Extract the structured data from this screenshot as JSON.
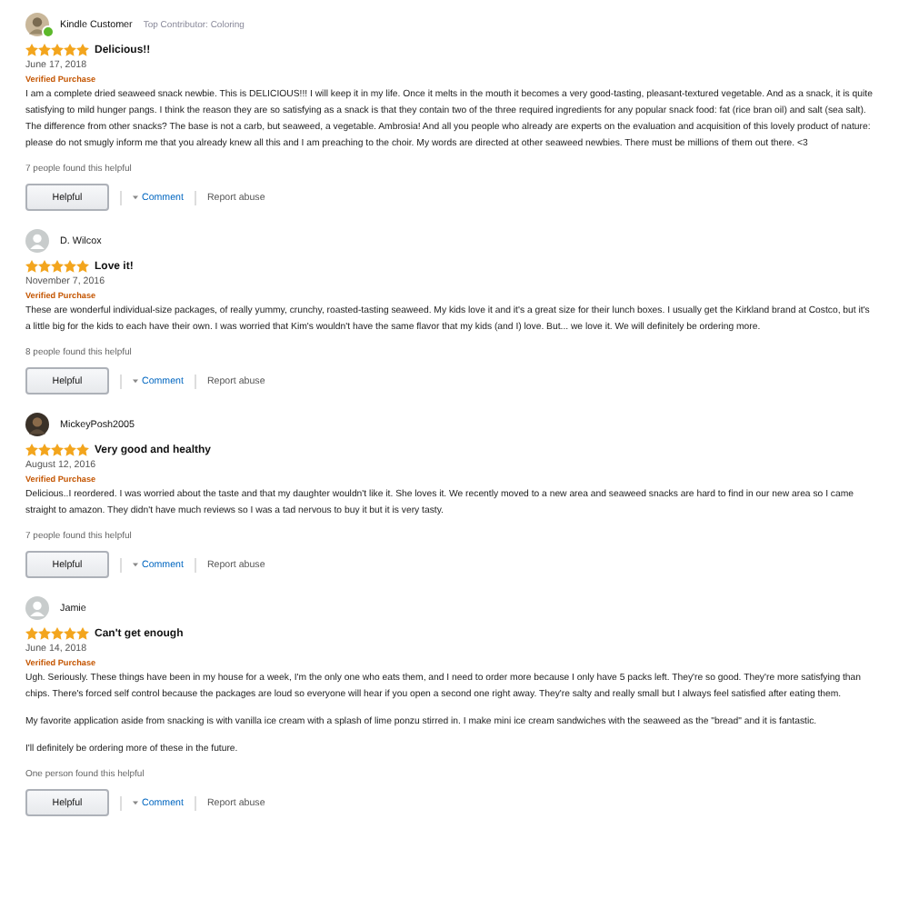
{
  "reviews": [
    {
      "reviewer": {
        "name": "Kindle Customer",
        "badge_text": "Top Contributor: Coloring",
        "online": true
      },
      "stars": 5,
      "title": "Delicious!!",
      "date": "June 17, 2018",
      "verified": "Verified Purchase",
      "body": [
        "I am a complete dried seaweed snack newbie. This is DELICIOUS!!! I will keep it in my life. Once it melts in the mouth it becomes a very good-tasting, pleasant-textured vegetable. And as a snack, it is quite satisfying to mild hunger pangs. I think the reason they are so satisfying as a snack is that they contain two of the three required ingredients for any popular snack food: fat (rice bran oil) and salt (sea salt). The difference from other snacks? The base is not a carb, but seaweed, a vegetable. Ambrosia! And all you people who already are experts on the evaluation and acquisition of this lovely product of nature: please do not smugly inform me that you already knew all this and I am preaching to the choir. My words are directed at other seaweed newbies. There must be millions of them out there. <3"
      ],
      "helpful_count": "7 people found this helpful",
      "helpful_button": "Helpful",
      "comment_link": "Comment",
      "report_link": "Report abuse"
    },
    {
      "reviewer": {
        "name": "D. Wilcox"
      },
      "stars": 5,
      "title": "Love it!",
      "date": "November 7, 2016",
      "verified": "Verified Purchase",
      "body": [
        "These are wonderful individual-size packages, of really yummy, crunchy, roasted-tasting seaweed. My kids love it and it's a great size for their lunch boxes. I usually get the Kirkland brand at Costco, but it's a little big for the kids to each have their own. I was worried that Kim's wouldn't have the same flavor that my kids (and I) love. But... we love it. We will definitely be ordering more."
      ],
      "helpful_count": "8 people found this helpful",
      "helpful_button": "Helpful",
      "comment_link": "Comment",
      "report_link": "Report abuse"
    },
    {
      "reviewer": {
        "name": "MickeyPosh2005"
      },
      "stars": 5,
      "title": "Very good and healthy",
      "date": "August 12, 2016",
      "verified": "Verified Purchase",
      "body": [
        "Delicious..I reordered. I was worried about the taste and that my daughter wouldn't like it. She loves it. We recently moved to a new area and seaweed snacks are hard to find in our new area so I came straight to amazon. They didn't have much reviews so I was a tad nervous to buy it but it is very tasty."
      ],
      "helpful_count": "7 people found this helpful",
      "helpful_button": "Helpful",
      "comment_link": "Comment",
      "report_link": "Report abuse"
    },
    {
      "reviewer": {
        "name": "Jamie"
      },
      "stars": 5,
      "title": "Can't get enough",
      "date": "June 14, 2018",
      "verified": "Verified Purchase",
      "body": [
        "Ugh. Seriously. These things have been in my house for a week, I'm the only one who eats them, and I need to order more because I only have 5 packs left. They're so good. They're more satisfying than chips. There's forced self control because the packages are loud so everyone will hear if you open a second one right away. They're salty and really small but I always feel satisfied after eating them.",
        "My favorite application aside from snacking is with vanilla ice cream with a splash of lime ponzu stirred in. I make mini ice cream sandwiches with the seaweed as the \"bread\" and it is fantastic.",
        "I'll definitely be ordering more of these in the future."
      ],
      "helpful_count": "One person found this helpful",
      "helpful_button": "Helpful",
      "comment_link": "Comment",
      "report_link": "Report abuse"
    }
  ]
}
